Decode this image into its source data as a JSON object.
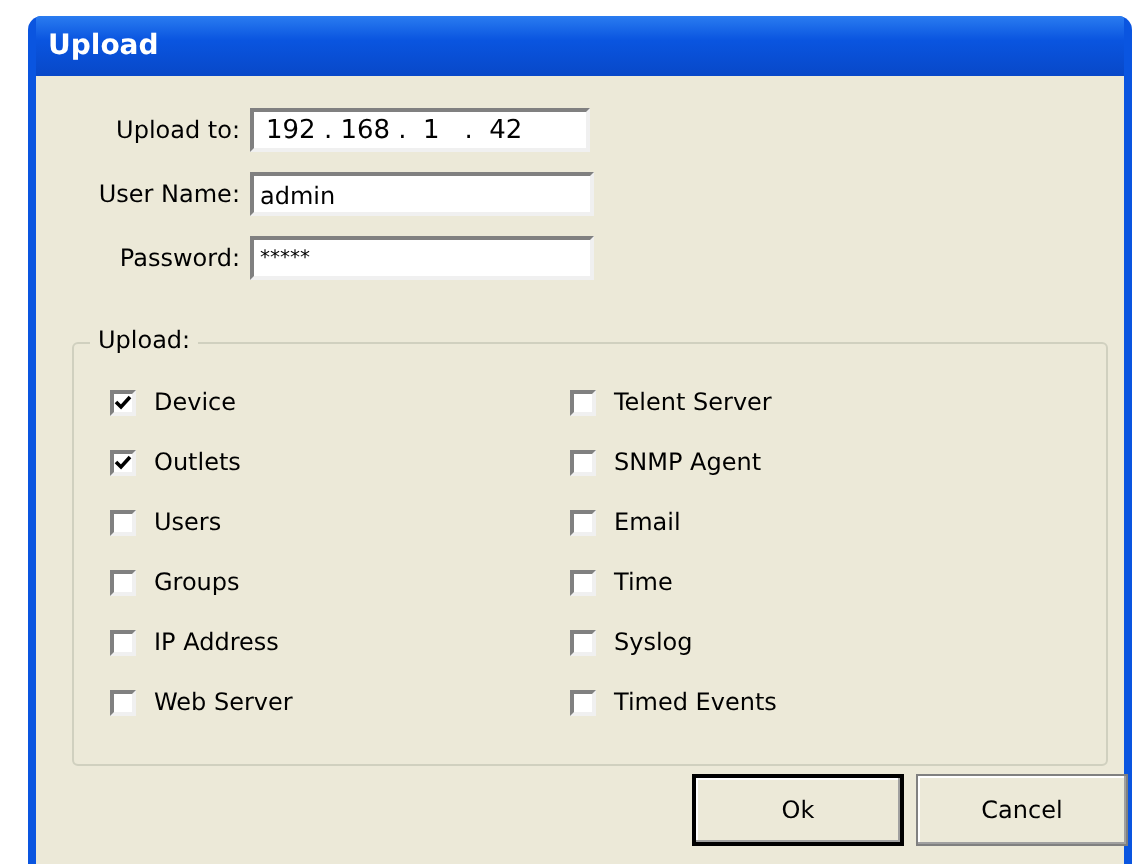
{
  "window": {
    "title": "Upload"
  },
  "fields": [
    {
      "label": "Upload to:",
      "value": "192 . 168 .  1   .  42",
      "kind": "ip"
    },
    {
      "label": "User Name:",
      "value": "admin",
      "kind": "text"
    },
    {
      "label": "Password:",
      "value": "*****",
      "kind": "password"
    }
  ],
  "group": {
    "title": "Upload:",
    "options": [
      {
        "label": "Device",
        "checked": true
      },
      {
        "label": "Outlets",
        "checked": true
      },
      {
        "label": "Users",
        "checked": false
      },
      {
        "label": "Groups",
        "checked": false
      },
      {
        "label": "IP Address",
        "checked": false
      },
      {
        "label": "Web Server",
        "checked": false
      },
      {
        "label": "Telent Server",
        "checked": false
      },
      {
        "label": "SNMP Agent",
        "checked": false
      },
      {
        "label": "Email",
        "checked": false
      },
      {
        "label": "Time",
        "checked": false
      },
      {
        "label": "Syslog",
        "checked": false
      },
      {
        "label": "Timed Events",
        "checked": false
      }
    ]
  },
  "buttons": [
    {
      "label": "Ok",
      "kind": "default"
    },
    {
      "label": "Cancel",
      "kind": "normal"
    }
  ]
}
